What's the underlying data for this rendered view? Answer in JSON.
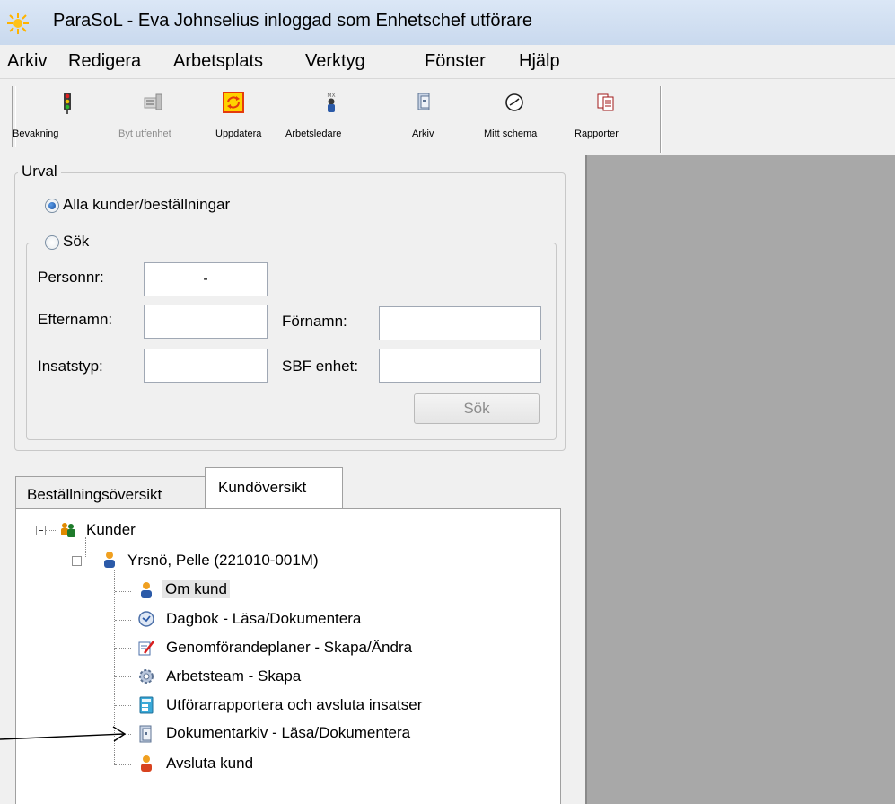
{
  "window": {
    "title": "ParaSoL - Eva Johnselius inloggad som Enhetschef utförare"
  },
  "menu": [
    "Arkiv",
    "Redigera",
    "Arbetsplats",
    "Verktyg",
    "Fönster",
    "Hjälp"
  ],
  "toolbar": [
    {
      "label": "Bevakning",
      "icon": "traffic-light-icon",
      "enabled": true
    },
    {
      "label": "Byt utfenhet",
      "icon": "switch-unit-icon",
      "enabled": false
    },
    {
      "label": "Uppdatera",
      "icon": "refresh-icon",
      "enabled": true
    },
    {
      "label": "Arbetsledare",
      "icon": "supervisor-icon",
      "enabled": true
    },
    {
      "label": "Arkiv",
      "icon": "archive-icon",
      "enabled": true
    },
    {
      "label": "Mitt schema",
      "icon": "clock-icon",
      "enabled": true
    },
    {
      "label": "Rapporter",
      "icon": "reports-icon",
      "enabled": true
    }
  ],
  "urval": {
    "label": "Urval",
    "option_all": "Alla kunder/beställningar",
    "option_all_selected": true,
    "option_search": "Sök",
    "fields": {
      "personnr_label": "Personnr:",
      "personnr_value": "-",
      "efternamn_label": "Efternamn:",
      "fornamn_label": "Förnamn:",
      "insatstyp_label": "Insatstyp:",
      "sbf_label": "SBF enhet:"
    },
    "search_button": "Sök"
  },
  "tabs": [
    {
      "label": "Beställningsöversikt",
      "active": false
    },
    {
      "label": "Kundöversikt",
      "active": true
    }
  ],
  "tree": {
    "root": "Kunder",
    "customer": "Yrsnö, Pelle (221010-001M)",
    "children": [
      {
        "label": "Om kund",
        "icon": "user-icon",
        "selected": true
      },
      {
        "label": "Dagbok - Läsa/Dokumentera",
        "icon": "diary-clock-icon"
      },
      {
        "label": "Genomförandeplaner - Skapa/Ändra",
        "icon": "plan-edit-icon"
      },
      {
        "label": "Arbetsteam - Skapa",
        "icon": "team-gear-icon"
      },
      {
        "label": "Utförarrapportera och avsluta insatser",
        "icon": "calculator-icon"
      },
      {
        "label": "Dokumentarkiv - Läsa/Dokumentera",
        "icon": "document-archive-icon"
      },
      {
        "label": "Avsluta kund",
        "icon": "end-customer-icon"
      }
    ]
  },
  "colors": {
    "title_bar": "#c9d9ee",
    "panel": "#f0f0f0",
    "workspace": "#a8a8a8",
    "refresh_icon": "#e53b0c"
  }
}
